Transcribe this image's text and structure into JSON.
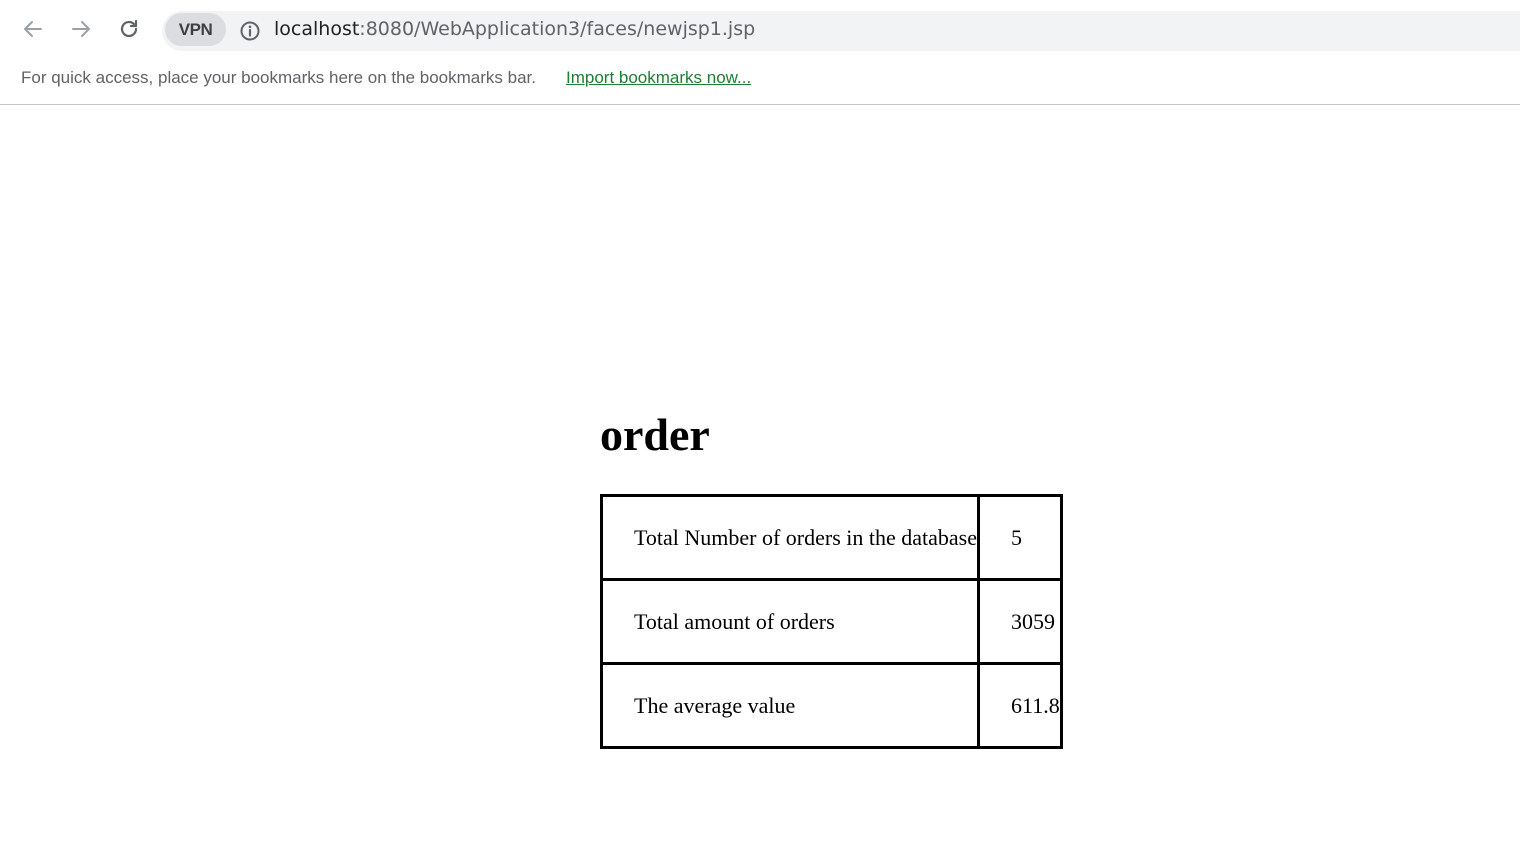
{
  "browser": {
    "vpn_label": "VPN",
    "url": {
      "host": "localhost",
      "rest": ":8080/WebApplication3/faces/newjsp1.jsp"
    },
    "icons": {
      "back": "arrow-left-icon",
      "forward": "arrow-right-icon",
      "reload": "reload-icon",
      "site_info": "info-circle-icon"
    }
  },
  "bookmarks_bar": {
    "message": "For quick access, place your bookmarks here on the bookmarks bar.",
    "import_link": "Import bookmarks now..."
  },
  "page": {
    "title": "order",
    "rows": [
      {
        "label": "Total Number of orders in the database",
        "value": "5"
      },
      {
        "label": "Total amount of orders",
        "value": "3059"
      },
      {
        "label": "The average value",
        "value": "611.8"
      }
    ]
  }
}
